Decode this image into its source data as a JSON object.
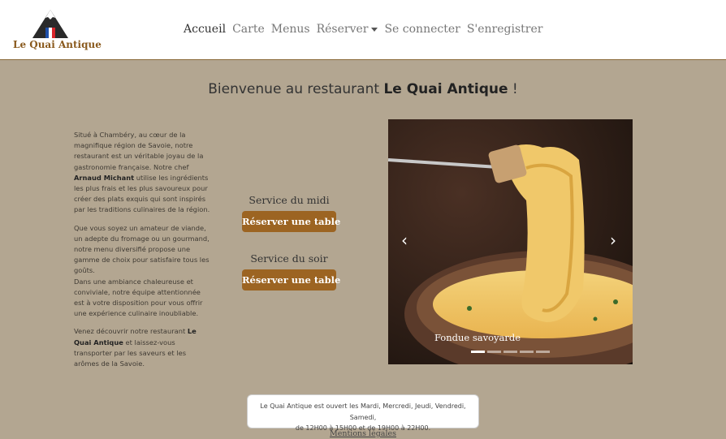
{
  "brand": {
    "name": "Le Quai Antique"
  },
  "nav": {
    "items": [
      "Accueil",
      "Carte",
      "Menus",
      "Réserver",
      "Se connecter",
      "S'enregistrer"
    ]
  },
  "welcome": {
    "prefix": "Bienvenue au restaurant ",
    "name": "Le Quai Antique",
    "suffix": " !"
  },
  "about": {
    "p1_a": "Situé à Chambéry, au cœur de la magnifique région de Savoie, notre restaurant est un véritable joyau de la gastronomie française. Notre chef ",
    "p1_chef": "Arnaud Michant",
    "p1_b": " utilise les ingrédients les plus frais et les plus savoureux pour créer des plats exquis qui sont inspirés par les traditions culinaires de la région.",
    "p2": "Que vous soyez un amateur de viande, un adepte du fromage ou un gourmand, notre menu diversifié propose une gamme de choix pour satisfaire tous les goûts.",
    "p2b": "Dans une ambiance chaleureuse et conviviale, notre équipe attentionnée est à votre disposition pour vous offrir une expérience culinaire inoubliable.",
    "p3_a": "Venez découvrir notre restaurant ",
    "p3_name": "Le Quai Antique",
    "p3_b": " et laissez-vous transporter par les saveurs et les arômes de la Savoie."
  },
  "services": [
    {
      "label": "Service du midi",
      "button": "Réserver une table"
    },
    {
      "label": "Service du soir",
      "button": "Réserver une table"
    }
  ],
  "carousel": {
    "caption": "Fondue savoyarde",
    "slides": 5,
    "active_index": 0
  },
  "hours": {
    "line1": "Le Quai Antique est ouvert les Mardi, Mercredi, Jeudi, Vendredi, Samedi,",
    "line2": "de 12H00 à 15H00 et de 19H00 à 22H00."
  },
  "footer": {
    "legal": "Mentions légales"
  },
  "colors": {
    "background": "#b3a691",
    "accent": "#9c6422",
    "brand_text": "#8a5a1e"
  }
}
